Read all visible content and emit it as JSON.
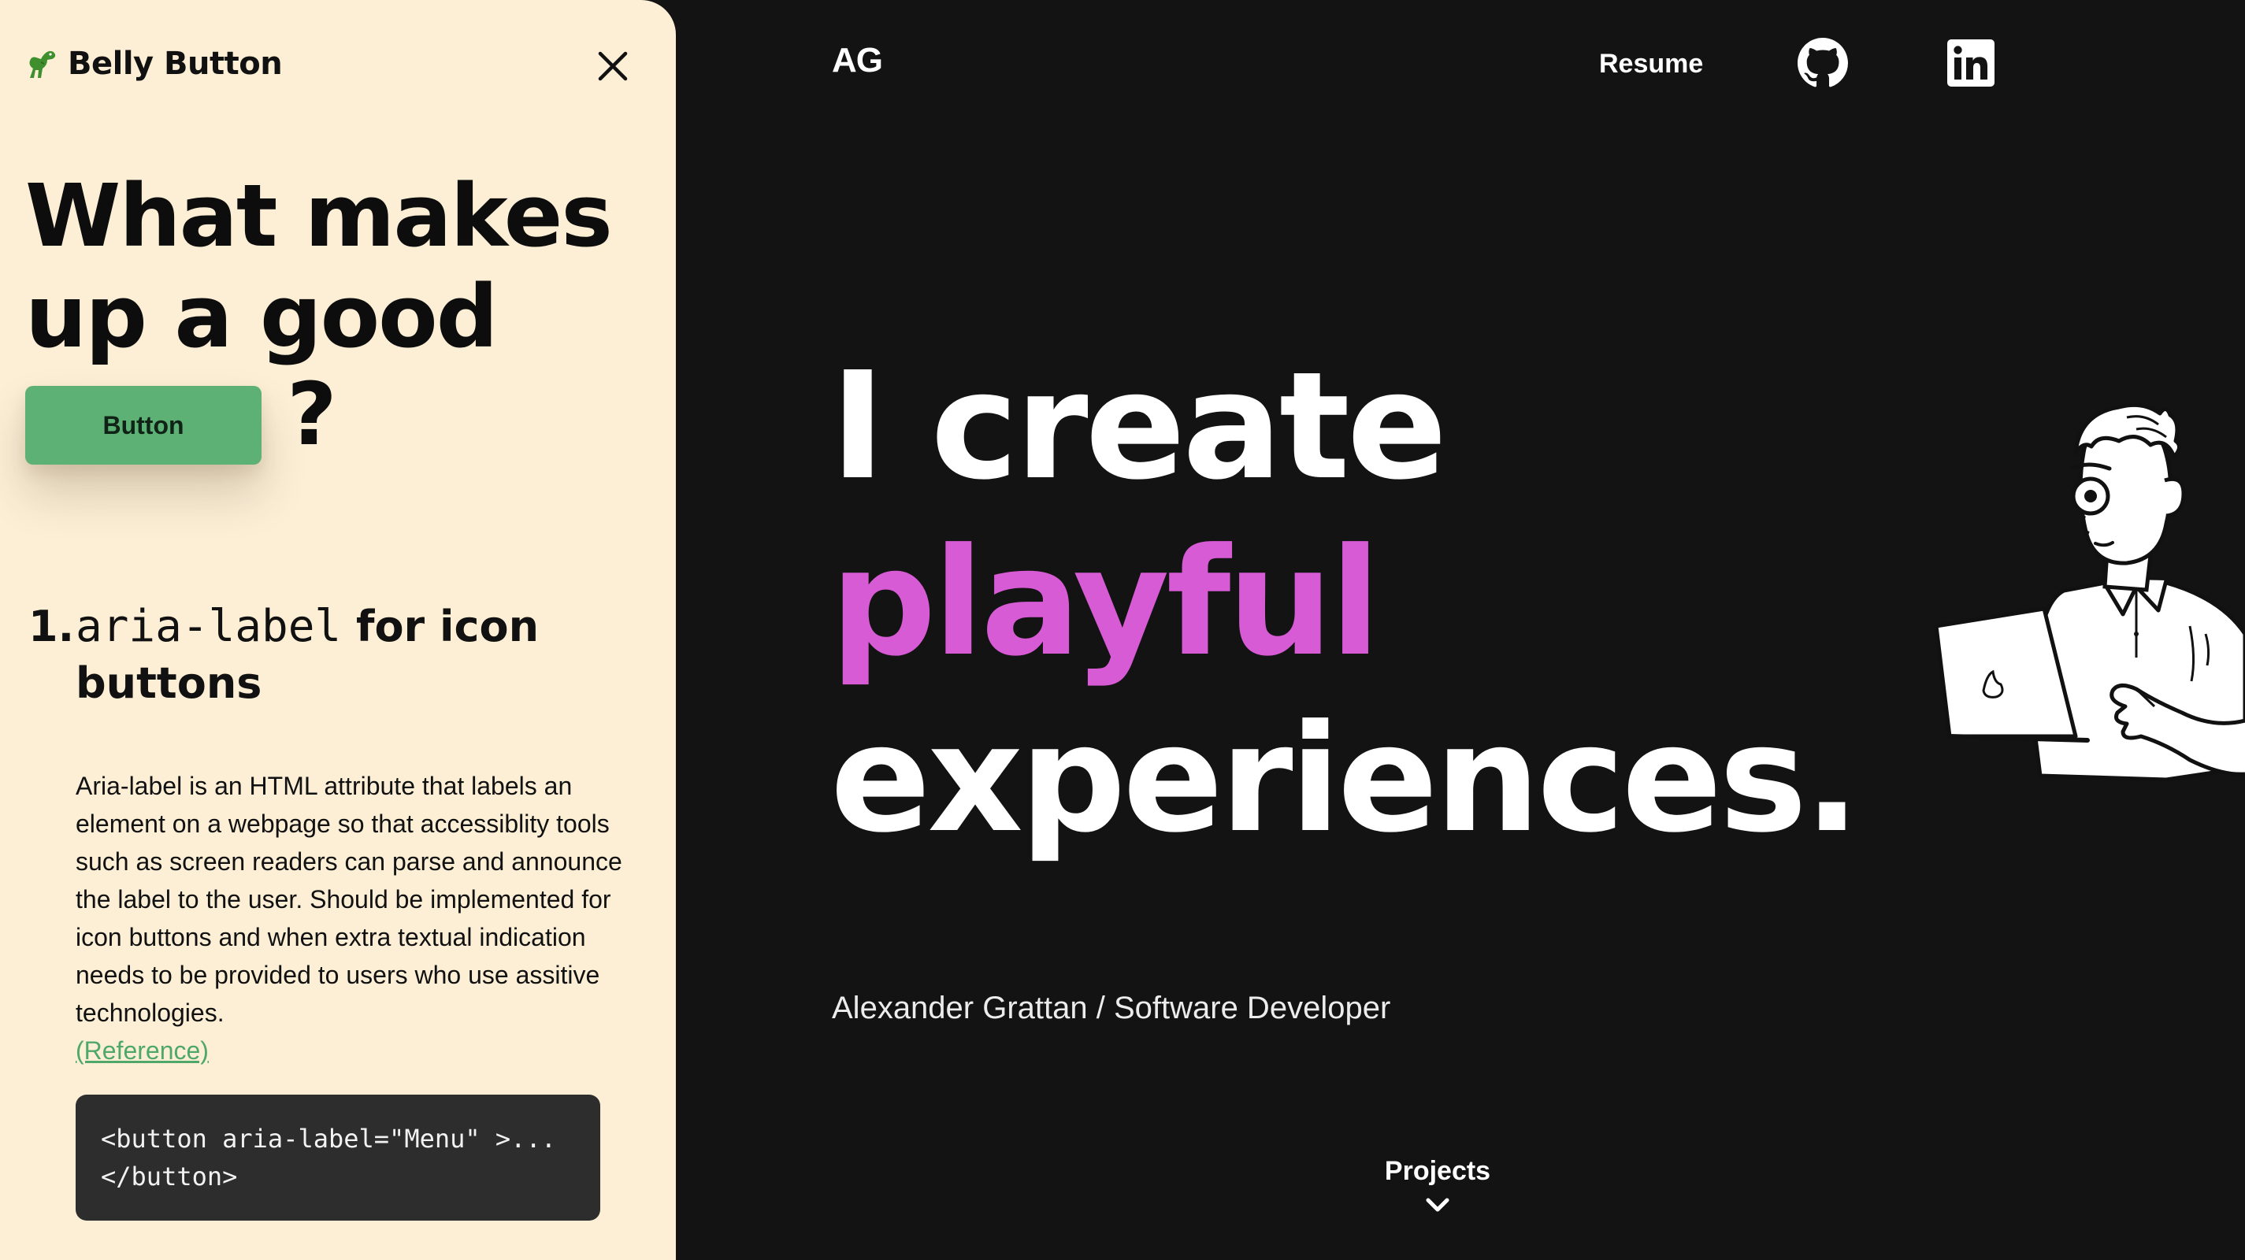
{
  "panel": {
    "brand_emoji_icon": "dinosaur-icon",
    "brand_title": "Belly Button",
    "close_icon": "close-icon",
    "headline_line1": "What makes",
    "headline_line2": "up a good",
    "demo_button_label": "Button",
    "headline_qmark": "?",
    "section": {
      "number": "1.",
      "code_word": "aria-label",
      "title_rest": " for icon buttons"
    },
    "description": "Aria-label is an HTML attribute that labels an element on a webpage so that accessiblity tools such as screen readers can parse and announce the label to the user. Should be implemented for icon buttons and when extra textual indication needs to be provided to users who use assitive technologies.",
    "reference_label": "(Reference)",
    "code_snippet": "<button aria-label=\"Menu\" >...\n</button>",
    "colors": {
      "background": "#fcefd6",
      "button_green": "#5eb174",
      "link_green": "#4fa86a"
    }
  },
  "site": {
    "logo": "AG",
    "nav": {
      "resume": "Resume",
      "github_icon": "github-icon",
      "linkedin_icon": "linkedin-icon"
    },
    "hero_line1": "I create",
    "hero_line2": "playful",
    "hero_line3": "experiences.",
    "subtitle": "Alexander Grattan / Software Developer",
    "projects_label": "Projects",
    "projects_icon": "chevron-down-icon",
    "illustration_icon": "developer-with-laptop-illustration",
    "colors": {
      "background": "#131313",
      "accent": "#d85bd6",
      "text": "#ffffff"
    }
  }
}
